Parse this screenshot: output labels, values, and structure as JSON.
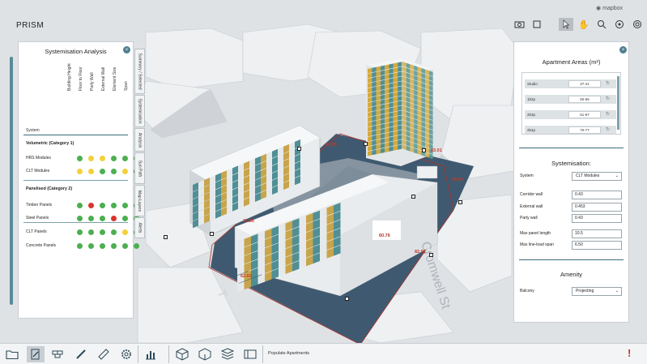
{
  "app": {
    "title": "PRISM"
  },
  "mapbox": {
    "label": "mapbox"
  },
  "map_tools": [
    "camera-icon",
    "select-icon",
    "pan-icon",
    "zoom-in-icon",
    "orbit-icon",
    "sun-icon",
    "zoom-search-icon"
  ],
  "systemisation": {
    "title": "Systemisation Analysis",
    "system_header": "System",
    "columns": [
      "Building Height",
      "Floor to Floor",
      "Party Wall",
      "External Wall",
      "Element Size",
      "Span"
    ],
    "categories": [
      {
        "label": "Volumetric (Category 1)",
        "rows": [
          {
            "name": "HRS Modules",
            "statuses": [
              "green",
              "yellow",
              "yellow",
              "green",
              "green",
              "green"
            ]
          },
          {
            "name": "CLT Modules",
            "statuses": [
              "yellow",
              "yellow",
              "green",
              "green",
              "yellow",
              "green"
            ]
          }
        ]
      },
      {
        "label": "Panelised (Category 2)",
        "rows": [
          {
            "name": "Timber Panels",
            "statuses": [
              "green",
              "red",
              "green",
              "green",
              "green",
              "green"
            ]
          },
          {
            "name": "Steel Panels",
            "statuses": [
              "green",
              "green",
              "green",
              "red",
              "green",
              "green"
            ]
          },
          {
            "name": "CLT Panels",
            "statuses": [
              "green",
              "green",
              "green",
              "green",
              "yellow",
              "green"
            ]
          },
          {
            "name": "Concrete Panels",
            "statuses": [
              "green",
              "green",
              "green",
              "green",
              "green",
              "green"
            ]
          }
        ]
      }
    ]
  },
  "side_tabs": [
    "Summary / Selected",
    "Systemisation",
    "Analysis",
    "Sun Path",
    "Map Layers",
    "Alerts"
  ],
  "apartment_areas": {
    "title": "Apartment Areas (m²)",
    "rows": [
      {
        "label": "Studio",
        "value": "37-41"
      },
      {
        "label": "1b2p",
        "value": "50-55"
      },
      {
        "label": "2b3p",
        "value": "61-67"
      },
      {
        "label": "2b4p",
        "value": "70-77"
      }
    ]
  },
  "systemisation_settings": {
    "title": "Systemisation:",
    "system_label": "System",
    "system_value": "CLT Modules",
    "fields": [
      {
        "label": "Corridor wall",
        "value": "0.43"
      },
      {
        "label": "External wall",
        "value": "0.453"
      },
      {
        "label": "Party wall",
        "value": "0.43"
      },
      {
        "label": "Max panel length",
        "value": "10.5"
      },
      {
        "label": "Max line-load span",
        "value": "6.50"
      }
    ]
  },
  "amenity": {
    "title": "Amenity",
    "balcony_label": "Balcony",
    "balcony_value": "Projecting"
  },
  "scene_dimensions": [
    "41.95",
    "83.01",
    "45.64",
    "17.80",
    "60.76",
    "82.91",
    "62.02"
  ],
  "street_label": "Cromwell St",
  "bottom_bar": {
    "buttons": [
      "folder-icon",
      "edit-document-icon",
      "bricks-icon",
      "pencil-icon",
      "ruler-icon",
      "gear-icon",
      "bar-chart-icon",
      "cube-outline-icon",
      "cube-half-icon",
      "cube-stack-icon",
      "layout-icon"
    ],
    "populate_label": "Populate Apartments",
    "alert": "!"
  },
  "colors": {
    "teal": "#4f8f95",
    "ochre": "#c8a54a",
    "mustard": "#d4a93c",
    "status_green": "#4caf50",
    "status_yellow": "#f2d13b",
    "status_red": "#d9342b",
    "panel_accent": "#3b6b7a"
  }
}
